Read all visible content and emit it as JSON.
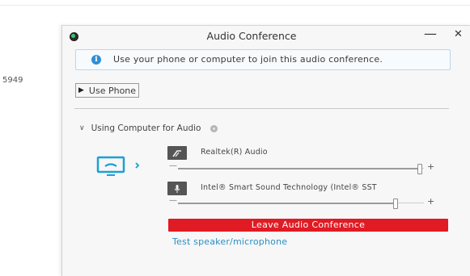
{
  "background": {
    "partial_number": "5949"
  },
  "window": {
    "title": "Audio Conference",
    "minimize_label": "—",
    "close_label": "✕"
  },
  "info_bar": {
    "icon": "i",
    "text": "Use your phone or computer to join this audio conference."
  },
  "use_phone": {
    "label": "Use Phone"
  },
  "computer_audio": {
    "header": "Using Computer for Audio",
    "speaker": {
      "device": "Realtek(R) Audio",
      "volume_fraction": 0.98
    },
    "microphone": {
      "device": "Intel® Smart Sound Technology (Intel® SST",
      "volume_fraction": 0.88
    }
  },
  "leave_button": {
    "label": "Leave Audio Conference"
  },
  "test_link": {
    "label": "Test speaker/microphone"
  },
  "colors": {
    "leave": "#e01b24",
    "link": "#2b8fc4",
    "monitor": "#1aa0d8",
    "info": "#2f8fd6"
  }
}
